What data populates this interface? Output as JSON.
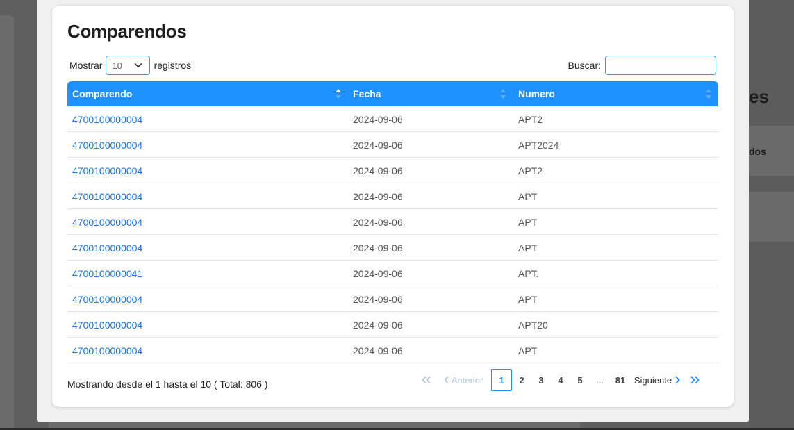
{
  "background": {
    "title_fragment": "es",
    "subtitle_fragment": "dos"
  },
  "modal": {
    "title": "Comparendos",
    "length": {
      "label_before": "Mostrar",
      "selected": "10",
      "label_after": "registros"
    },
    "search": {
      "label": "Buscar:",
      "value": "",
      "placeholder": ""
    },
    "columns": [
      "Comparendo",
      "Fecha",
      "Numero"
    ],
    "rows": [
      {
        "comparendo": "4700100000004",
        "fecha": "2024-09-06",
        "numero": "APT2"
      },
      {
        "comparendo": "4700100000004",
        "fecha": "2024-09-06",
        "numero": "APT2024"
      },
      {
        "comparendo": "4700100000004",
        "fecha": "2024-09-06",
        "numero": "APT2"
      },
      {
        "comparendo": "4700100000004",
        "fecha": "2024-09-06",
        "numero": "APT"
      },
      {
        "comparendo": "4700100000004",
        "fecha": "2024-09-06",
        "numero": "APT"
      },
      {
        "comparendo": "4700100000004",
        "fecha": "2024-09-06",
        "numero": "APT"
      },
      {
        "comparendo": "4700100000041",
        "fecha": "2024-09-06",
        "numero": "APT."
      },
      {
        "comparendo": "4700100000004",
        "fecha": "2024-09-06",
        "numero": "APT"
      },
      {
        "comparendo": "4700100000004",
        "fecha": "2024-09-06",
        "numero": "APT20"
      },
      {
        "comparendo": "4700100000004",
        "fecha": "2024-09-06",
        "numero": "APT"
      }
    ],
    "info": "Mostrando desde el 1 hasta el 10 ( Total: 806 )",
    "pagination": {
      "first_icon": "double-chevron-left-icon",
      "prev": "Anterior",
      "pages": [
        "1",
        "2",
        "3",
        "4",
        "5"
      ],
      "dots": "...",
      "last_page": "81",
      "next": "Siguiente",
      "last_icon": "double-chevron-right-icon",
      "current": "1"
    }
  },
  "colors": {
    "header_bg": "#1e90ff",
    "link": "#1a73d9",
    "accent": "#1e90ff"
  }
}
